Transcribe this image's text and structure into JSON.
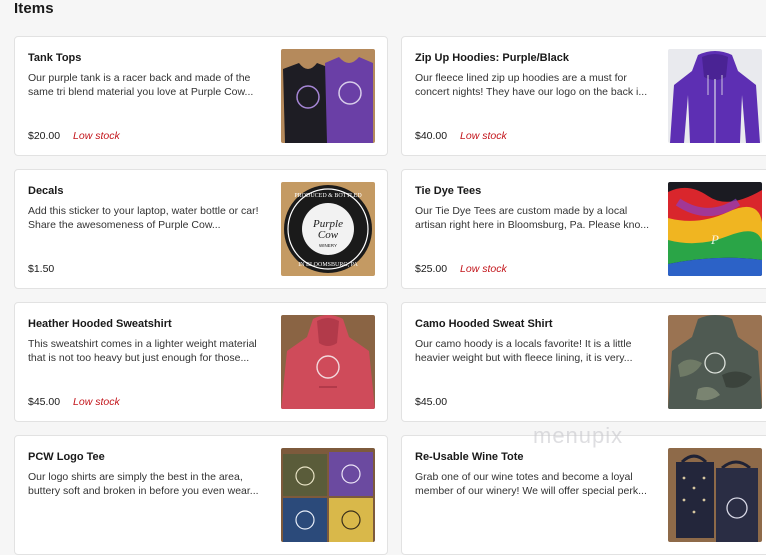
{
  "section": {
    "title": "Items"
  },
  "items": [
    {
      "name": "Tank Tops",
      "description": "Our purple tank is a racer back and made of the same tri blend material you love at Purple Cow...",
      "price": "$20.00",
      "stock": "Low stock",
      "thumb": "tank-tops-photo"
    },
    {
      "name": "Zip Up Hoodies: Purple/Black",
      "description": "Our fleece lined zip up hoodies are a must for concert nights! They have our logo on the back i...",
      "price": "$40.00",
      "stock": "Low stock",
      "thumb": "zip-hoodie-photo"
    },
    {
      "name": "Decals",
      "description": "Add this sticker to your laptop, water bottle or car! Share the awesomeness of Purple Cow...",
      "price": "$1.50",
      "stock": "",
      "thumb": "decal-photo"
    },
    {
      "name": "Tie Dye Tees",
      "description": "Our Tie Dye Tees are custom made by a local artisan right here in Bloomsburg, Pa. Please kno...",
      "price": "$25.00",
      "stock": "Low stock",
      "thumb": "tie-dye-photo"
    },
    {
      "name": "Heather Hooded Sweatshirt",
      "description": "This sweatshirt comes in a lighter weight material that is not too heavy but just enough for those...",
      "price": "$45.00",
      "stock": "Low stock",
      "thumb": "heather-hoodie-photo"
    },
    {
      "name": "Camo Hooded Sweat Shirt",
      "description": "Our camo hoody is a locals favorite! It is a little heavier weight but with fleece lining, it is very...",
      "price": "$45.00",
      "stock": "",
      "thumb": "camo-hoodie-photo"
    },
    {
      "name": "PCW Logo Tee",
      "description": "Our logo shirts are simply the best in the area, buttery soft and broken in before you even wear...",
      "price": "",
      "stock": "",
      "thumb": "logo-tee-photo"
    },
    {
      "name": "Re-Usable Wine Tote",
      "description": "Grab one of our wine totes and become a loyal member of our winery! We will offer special perk...",
      "price": "",
      "stock": "",
      "thumb": "wine-tote-photo"
    }
  ],
  "decal_text": {
    "top": "PRODUCED & BOTTLED",
    "brand1": "Purple",
    "brand2": "Cow",
    "winery": "WINERY",
    "bottom": "IN BLOOMSBURG, PA"
  },
  "watermark": "menupix",
  "colors": {
    "low_stock": "#c3161c",
    "card_bg": "#ffffff",
    "page_bg": "#f6f6f6"
  }
}
